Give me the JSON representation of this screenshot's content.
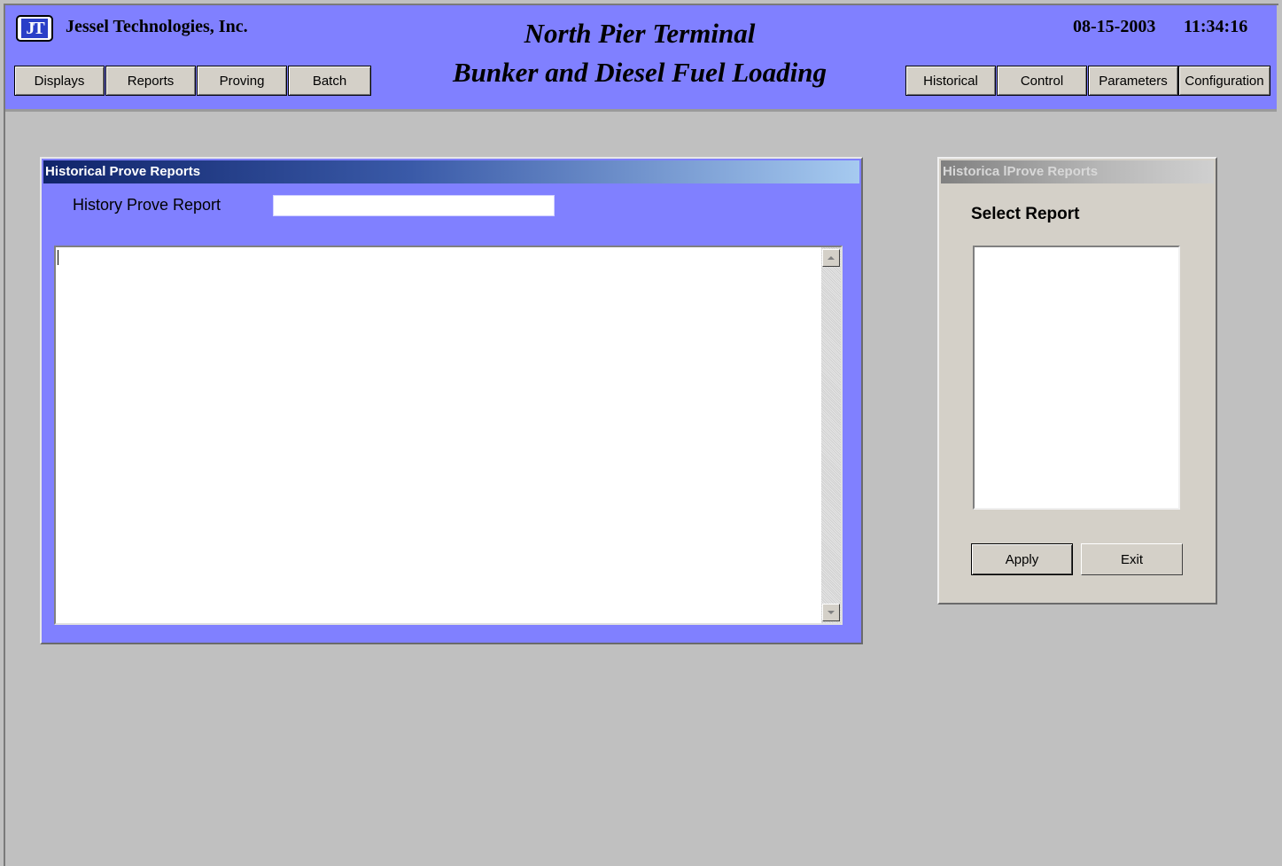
{
  "header": {
    "company": "Jessel Technologies, Inc.",
    "logo_text": "JT",
    "title_line1": "North Pier Terminal",
    "title_line2": "Bunker and Diesel Fuel Loading",
    "date": "08-15-2003",
    "time": "11:34:16",
    "nav_left": [
      "Displays",
      "Reports",
      "Proving",
      "Batch"
    ],
    "nav_right": [
      "Historical",
      "Control",
      "Parameters",
      "Configuration"
    ]
  },
  "left_panel": {
    "title": "Historical Prove Reports",
    "field_label": "History Prove Report",
    "field_value": "",
    "report_text": ""
  },
  "right_panel": {
    "title": "Historica lProve Reports",
    "select_label": "Select Report",
    "report_list": [],
    "apply_label": "Apply",
    "exit_label": "Exit"
  },
  "colors": {
    "header_bg": "#8080ff",
    "panel_bg": "#8080ff",
    "workspace_bg": "#c0c0c0",
    "button_face": "#d4d0c8"
  }
}
